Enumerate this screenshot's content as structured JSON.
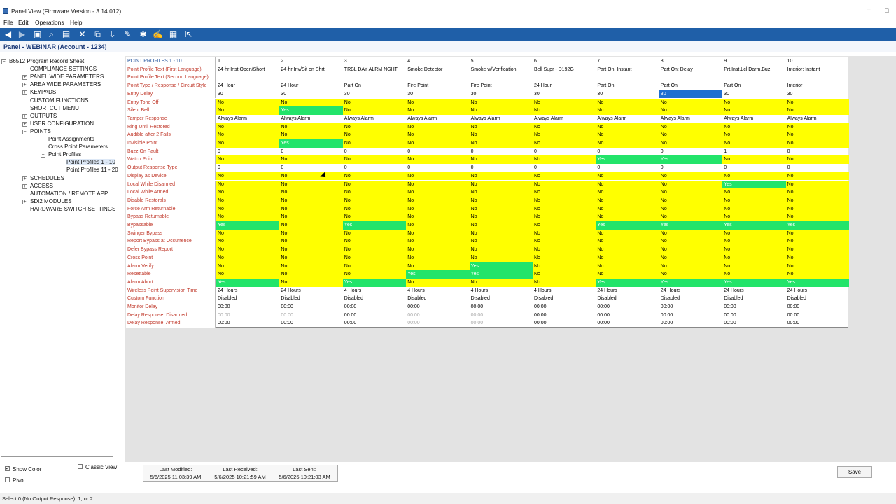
{
  "window": {
    "title": "Panel View (Firmware Version - 3.14.012)"
  },
  "menu": [
    "File",
    "Edit",
    "Operations",
    "Help"
  ],
  "toolbar_icons": [
    "back-icon",
    "forward-icon",
    "view-icon",
    "search-icon",
    "document-icon",
    "disconnect-icon",
    "copy-icon",
    "download-icon",
    "wrench-icon",
    "tools-icon",
    "edit-icon",
    "grid-icon",
    "export-icon"
  ],
  "panel_header": "Panel - WEBINAR (Account - 1234)",
  "tree": [
    {
      "label": "B6512 Program Record Sheet",
      "level": 0,
      "exp": "minus"
    },
    {
      "label": "COMPLIANCE SETTINGS",
      "level": 1,
      "exp": ""
    },
    {
      "label": "PANEL WIDE PARAMETERS",
      "level": 1,
      "exp": "plus"
    },
    {
      "label": "AREA WIDE PARAMETERS",
      "level": 1,
      "exp": "plus"
    },
    {
      "label": "KEYPADS",
      "level": 1,
      "exp": "plus"
    },
    {
      "label": "CUSTOM FUNCTIONS",
      "level": 1,
      "exp": ""
    },
    {
      "label": "SHORTCUT MENU",
      "level": 1,
      "exp": ""
    },
    {
      "label": "OUTPUTS",
      "level": 1,
      "exp": "plus"
    },
    {
      "label": "USER CONFIGURATION",
      "level": 1,
      "exp": "plus"
    },
    {
      "label": "POINTS",
      "level": 1,
      "exp": "minus"
    },
    {
      "label": "Point Assignments",
      "level": 2,
      "exp": ""
    },
    {
      "label": "Cross Point Parameters",
      "level": 2,
      "exp": ""
    },
    {
      "label": "Point Profiles",
      "level": 2,
      "exp": "minus"
    },
    {
      "label": "Point Profiles 1 - 10",
      "level": 3,
      "exp": "",
      "selected": true
    },
    {
      "label": "Point Profiles 11 - 20",
      "level": 3,
      "exp": ""
    },
    {
      "label": "SCHEDULES",
      "level": 1,
      "exp": "plus"
    },
    {
      "label": "ACCESS",
      "level": 1,
      "exp": "plus"
    },
    {
      "label": "AUTOMATION / REMOTE APP",
      "level": 1,
      "exp": ""
    },
    {
      "label": "SDI2 MODULES",
      "level": 1,
      "exp": "plus"
    },
    {
      "label": "HARDWARE SWITCH SETTINGS",
      "level": 1,
      "exp": ""
    }
  ],
  "grid": {
    "rows": [
      {
        "label": "POINT PROFILES 1 - 10",
        "hdr": true,
        "cells": [
          "1",
          "2",
          "3",
          "4",
          "5",
          "6",
          "7",
          "8",
          "9",
          "10"
        ],
        "style": "w"
      },
      {
        "label": "Point Profile Text (First Language)",
        "cells": [
          "24-hr Inst Open/Short",
          "24-hr Inv/Sit on Shrt",
          "TRBL DAY ALRM NGHT",
          "Smoke Detector",
          "Smoke w/Verification",
          "Bell Supr - D192G",
          "Part On: Instant",
          "Part On: Delay",
          "Prt.Inst,Lcl Darm,Buz",
          "Interior: Instant"
        ],
        "style": "w"
      },
      {
        "label": "Point Profile Text (Second Language)",
        "cells": [
          "",
          "",
          "",
          "",
          "",
          "",
          "",
          "",
          "",
          ""
        ],
        "style": "w"
      },
      {
        "label": "Point Type / Response / Circuit Style",
        "cells": [
          "24 Hour",
          "24 Hour",
          "Part On",
          "Fire Point",
          "Fire Point",
          "24 Hour",
          "Part On",
          "Part On",
          "Part On",
          "Interior"
        ],
        "style": "w"
      },
      {
        "label": "Entry Delay",
        "cells": [
          "30",
          "30",
          "30",
          "30",
          "30",
          "30",
          "30",
          "30",
          "30",
          "30"
        ],
        "style": "w",
        "sel": [
          7
        ]
      },
      {
        "label": "Entry Tone Off",
        "cells": [
          "No",
          "No",
          "No",
          "No",
          "No",
          "No",
          "No",
          "No",
          "No",
          "No"
        ],
        "style": "y"
      },
      {
        "label": "Silent Bell",
        "cells": [
          "No",
          "Yes",
          "No",
          "No",
          "No",
          "No",
          "No",
          "No",
          "No",
          "No"
        ],
        "style": "y",
        "green": [
          1
        ]
      },
      {
        "label": "Tamper Response",
        "cells": [
          "Always Alarm",
          "Always Alarm",
          "Always Alarm",
          "Always Alarm",
          "Always Alarm",
          "Always Alarm",
          "Always Alarm",
          "Always Alarm",
          "Always Alarm",
          "Always Alarm"
        ],
        "style": "w"
      },
      {
        "label": "Ring Until Restored",
        "cells": [
          "No",
          "No",
          "No",
          "No",
          "No",
          "No",
          "No",
          "No",
          "No",
          "No"
        ],
        "style": "y"
      },
      {
        "label": "Audible after 2 Fails",
        "cells": [
          "No",
          "No",
          "No",
          "No",
          "No",
          "No",
          "No",
          "No",
          "No",
          "No"
        ],
        "style": "y"
      },
      {
        "label": "Invisible Point",
        "cells": [
          "No",
          "Yes",
          "No",
          "No",
          "No",
          "No",
          "No",
          "No",
          "No",
          "No"
        ],
        "style": "y",
        "green": [
          1
        ]
      },
      {
        "label": "Buzz On Fault",
        "cells": [
          "0",
          "0",
          "0",
          "0",
          "0",
          "0",
          "0",
          "0",
          "1",
          "0"
        ],
        "style": "w"
      },
      {
        "label": "Watch Point",
        "cells": [
          "No",
          "No",
          "No",
          "No",
          "No",
          "No",
          "Yes",
          "Yes",
          "No",
          "No"
        ],
        "style": "y",
        "green": [
          6,
          7
        ]
      },
      {
        "label": "Output Response Type",
        "cells": [
          "0",
          "0",
          "0",
          "0",
          "0",
          "0",
          "0",
          "0",
          "0",
          "0"
        ],
        "style": "w"
      },
      {
        "label": "Display as Device",
        "cells": [
          "No",
          "No",
          "No",
          "No",
          "No",
          "No",
          "No",
          "No",
          "No",
          "No"
        ],
        "style": "y"
      },
      {
        "label": "Local While Disarmed",
        "cells": [
          "No",
          "No",
          "No",
          "No",
          "No",
          "No",
          "No",
          "No",
          "Yes",
          "No"
        ],
        "style": "y",
        "green": [
          8
        ]
      },
      {
        "label": "Local While Armed",
        "cells": [
          "No",
          "No",
          "No",
          "No",
          "No",
          "No",
          "No",
          "No",
          "No",
          "No"
        ],
        "style": "y"
      },
      {
        "label": "Disable Restorals",
        "cells": [
          "No",
          "No",
          "No",
          "No",
          "No",
          "No",
          "No",
          "No",
          "No",
          "No"
        ],
        "style": "y"
      },
      {
        "label": "Force Arm Returnable",
        "cells": [
          "No",
          "No",
          "No",
          "No",
          "No",
          "No",
          "No",
          "No",
          "No",
          "No"
        ],
        "style": "y"
      },
      {
        "label": "Bypass Returnable",
        "cells": [
          "No",
          "No",
          "No",
          "No",
          "No",
          "No",
          "No",
          "No",
          "No",
          "No"
        ],
        "style": "y"
      },
      {
        "label": "Bypassable",
        "cells": [
          "Yes",
          "No",
          "Yes",
          "No",
          "No",
          "No",
          "Yes",
          "Yes",
          "Yes",
          "Yes"
        ],
        "style": "y",
        "green": [
          0,
          2,
          6,
          7,
          8,
          9
        ]
      },
      {
        "label": "Swinger Bypass",
        "cells": [
          "No",
          "No",
          "No",
          "No",
          "No",
          "No",
          "No",
          "No",
          "No",
          "No"
        ],
        "style": "y"
      },
      {
        "label": "Report Bypass at Occurrence",
        "cells": [
          "No",
          "No",
          "No",
          "No",
          "No",
          "No",
          "No",
          "No",
          "No",
          "No"
        ],
        "style": "y"
      },
      {
        "label": "Defer Bypass Report",
        "cells": [
          "No",
          "No",
          "No",
          "No",
          "No",
          "No",
          "No",
          "No",
          "No",
          "No"
        ],
        "style": "y"
      },
      {
        "label": "Cross Point",
        "cells": [
          "No",
          "No",
          "No",
          "No",
          "No",
          "No",
          "No",
          "No",
          "No",
          "No"
        ],
        "style": "y"
      },
      {
        "label": "Alarm Verify",
        "cells": [
          "No",
          "No",
          "No",
          "No",
          "Yes",
          "No",
          "No",
          "No",
          "No",
          "No"
        ],
        "style": "y",
        "green": [
          4
        ]
      },
      {
        "label": "Resettable",
        "cells": [
          "No",
          "No",
          "No",
          "Yes",
          "Yes",
          "No",
          "No",
          "No",
          "No",
          "No"
        ],
        "style": "y",
        "green": [
          3,
          4
        ]
      },
      {
        "label": "Alarm Abort",
        "cells": [
          "Yes",
          "No",
          "Yes",
          "No",
          "No",
          "No",
          "Yes",
          "Yes",
          "Yes",
          "Yes"
        ],
        "style": "y",
        "green": [
          0,
          2,
          6,
          7,
          8,
          9
        ]
      },
      {
        "label": "Wireless Point Supervision Time",
        "cells": [
          "24 Hours",
          "24 Hours",
          "4 Hours",
          "4 Hours",
          "4 Hours",
          "4 Hours",
          "24 Hours",
          "24 Hours",
          "24 Hours",
          "24 Hours"
        ],
        "style": "w"
      },
      {
        "label": "Custom Function",
        "cells": [
          "Disabled",
          "Disabled",
          "Disabled",
          "Disabled",
          "Disabled",
          "Disabled",
          "Disabled",
          "Disabled",
          "Disabled",
          "Disabled"
        ],
        "style": "w"
      },
      {
        "label": "Monitor Delay",
        "cells": [
          "00:00",
          "00:00",
          "00:00",
          "00:00",
          "00:00",
          "00:00",
          "00:00",
          "00:00",
          "00:00",
          "00:00"
        ],
        "style": "w"
      },
      {
        "label": "Delay Response, Disarmed",
        "cells": [
          "00:00",
          "00:00",
          "00:00",
          "00:00",
          "00:00",
          "00:00",
          "00:00",
          "00:00",
          "00:00",
          "00:00"
        ],
        "style": "w",
        "dim": [
          0,
          1,
          3,
          4
        ]
      },
      {
        "label": "Delay Response, Armed",
        "cells": [
          "00:00",
          "00:00",
          "00:00",
          "00:00",
          "00:00",
          "00:00",
          "00:00",
          "00:00",
          "00:00",
          "00:00"
        ],
        "style": "w",
        "dim": [
          3,
          4
        ]
      }
    ]
  },
  "bottom": {
    "show_color": "Show Color",
    "classic_view": "Classic View",
    "pivot": "Pivot",
    "last_modified_label": "Last Modified:",
    "last_modified": "5/6/2025 11:03:39 AM",
    "last_received_label": "Last Received:",
    "last_received": "5/6/2025 10:21:59 AM",
    "last_sent_label": "Last Sent:",
    "last_sent": "5/6/2025 10:21:03 AM",
    "save": "Save"
  },
  "status": "Select 0 (No Output Response), 1, or 2."
}
